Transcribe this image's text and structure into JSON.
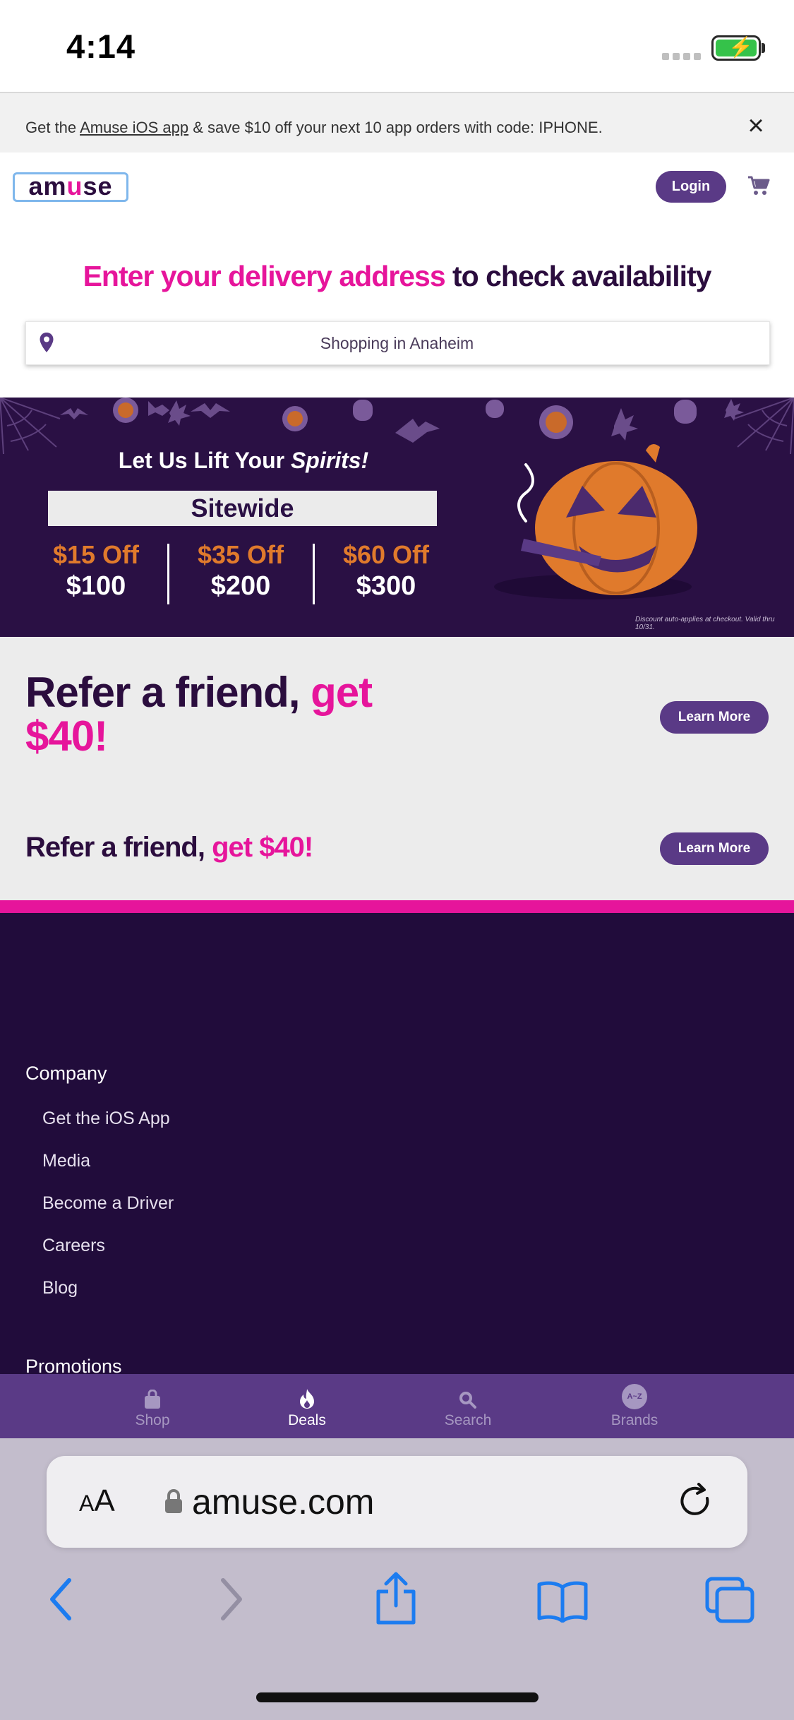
{
  "status_bar": {
    "time": "4:14"
  },
  "promo_banner": {
    "prefix": "Get the ",
    "link": "Amuse iOS app",
    "suffix": " & save $10 off your next 10 app orders with code: IPHONE."
  },
  "header": {
    "logo_a": "am",
    "logo_u": "u",
    "logo_b": "se",
    "login_label": "Login"
  },
  "delivery": {
    "heading_pink": "Enter your delivery address",
    "heading_dark": " to check availability",
    "address_value": "Shopping in Anaheim"
  },
  "halloween_banner": {
    "title_start": "Let Us Lift Your ",
    "title_italic": "Spirits!",
    "sitewide": "Sitewide",
    "tiers": [
      {
        "off": "$15 Off",
        "min": "$100"
      },
      {
        "off": "$35 Off",
        "min": "$200"
      },
      {
        "off": "$60 Off",
        "min": "$300"
      }
    ],
    "footnote": "Discount auto-applies at checkout. Valid thru 10/31."
  },
  "refer_large": {
    "text_dark": "Refer a friend, ",
    "text_pink": "get $40!",
    "button_label": "Learn More"
  },
  "refer_small": {
    "text_dark": "Refer a friend, ",
    "text_pink": "get $40!",
    "button_label": "Learn More"
  },
  "footer": {
    "company_heading": "Company",
    "company_links": [
      "Get the iOS App",
      "Media",
      "Become a Driver",
      "Careers",
      "Blog"
    ],
    "promotions_heading": "Promotions"
  },
  "tab_bar": {
    "tabs": [
      {
        "label": "Shop",
        "icon": "bag-icon"
      },
      {
        "label": "Deals",
        "icon": "flame-icon",
        "active": true
      },
      {
        "label": "Search",
        "icon": "search-icon"
      },
      {
        "label": "Brands",
        "icon": "brands-az-icon",
        "badge": "A~Z"
      }
    ]
  },
  "safari": {
    "aa_label_small": "A",
    "aa_label_big": "A",
    "url": "amuse.com"
  },
  "colors": {
    "brand_pink": "#e6159b",
    "brand_purple": "#5a3a86",
    "dark_purple": "#210c3b",
    "halloween_orange": "#e07a2c"
  }
}
